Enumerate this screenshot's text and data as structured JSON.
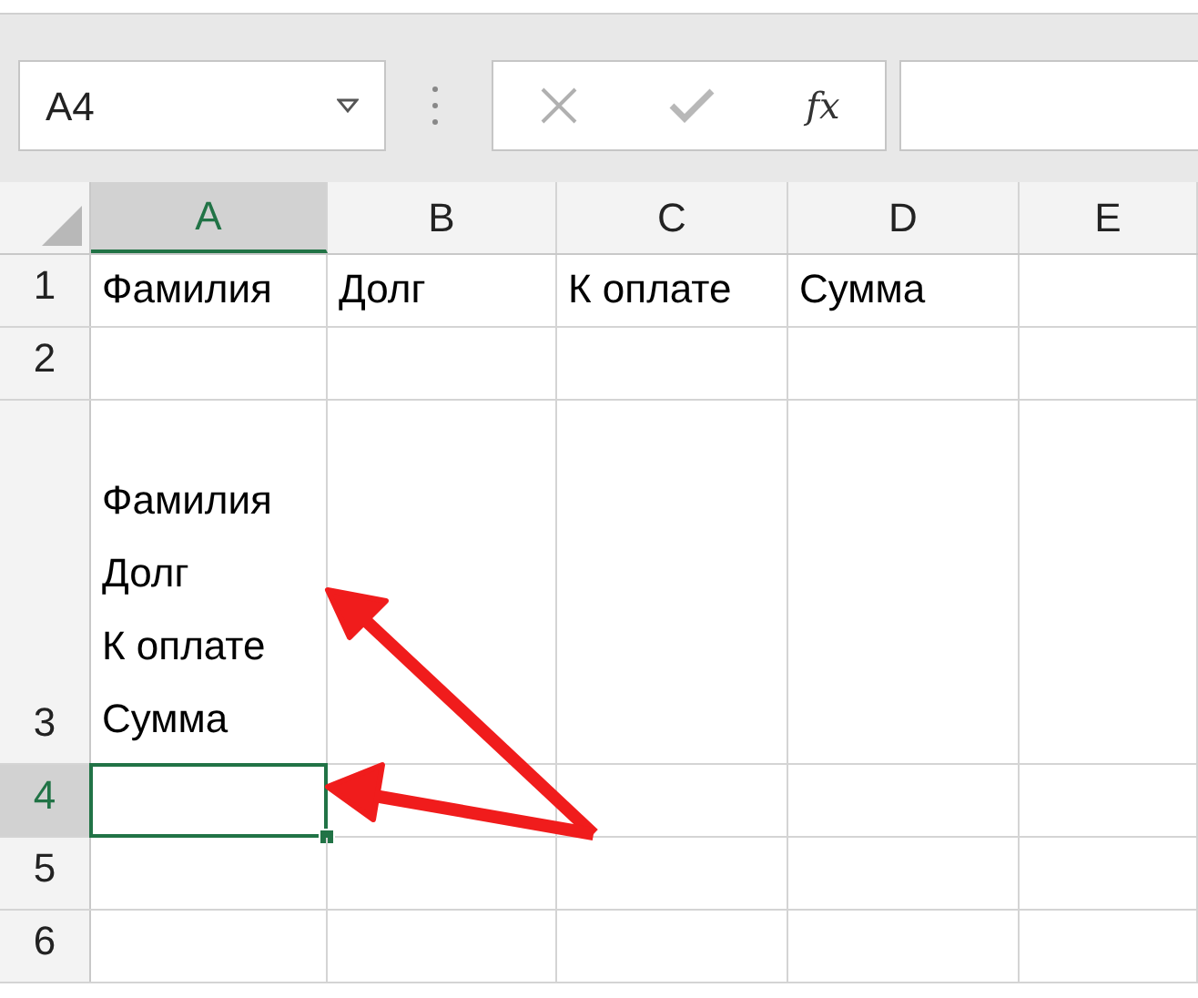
{
  "name_box": {
    "value": "A4"
  },
  "formula_bar": {
    "function_label": "fx"
  },
  "columns": [
    {
      "label": "A",
      "selected": true
    },
    {
      "label": "B",
      "selected": false
    },
    {
      "label": "C",
      "selected": false
    },
    {
      "label": "D",
      "selected": false
    },
    {
      "label": "E",
      "selected": false
    }
  ],
  "rows": [
    {
      "label": "1",
      "selected": false,
      "cells": {
        "A": "Фамилия",
        "B": "Долг",
        "C": "К оплате",
        "D": "Сумма"
      }
    },
    {
      "label": "2",
      "selected": false,
      "cells": {}
    },
    {
      "label": "3",
      "selected": false,
      "cells": {
        "A": [
          "Фамилия",
          "Долг",
          "К оплате",
          "Сумма"
        ]
      }
    },
    {
      "label": "4",
      "selected": true,
      "cells": {}
    },
    {
      "label": "5",
      "selected": false,
      "cells": {}
    },
    {
      "label": "6",
      "selected": false,
      "cells": {}
    }
  ]
}
